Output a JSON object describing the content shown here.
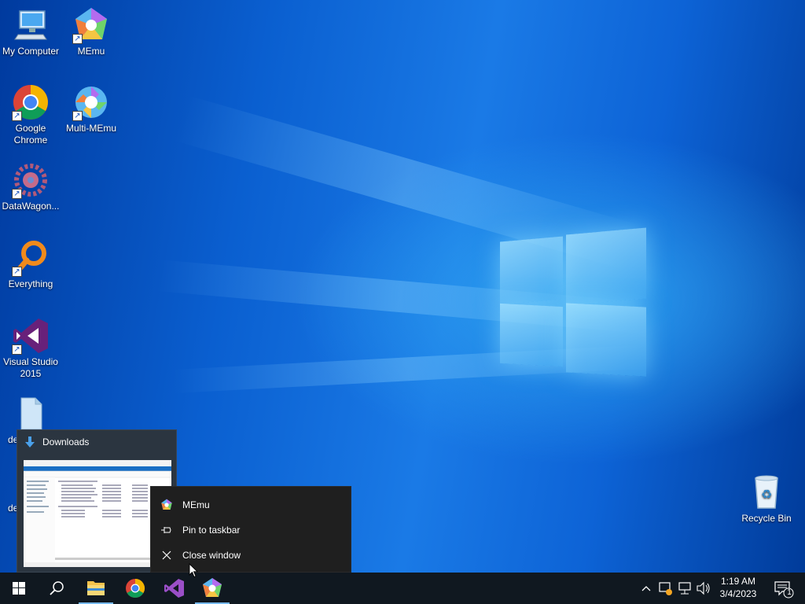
{
  "desktop": {
    "icons": [
      {
        "label": "My Computer",
        "icon": "monitor-icon"
      },
      {
        "label": "MEmu",
        "icon": "memu-icon"
      },
      {
        "label": "Google Chrome",
        "icon": "chrome-icon"
      },
      {
        "label": "Multi-MEmu",
        "icon": "multi-memu-icon"
      },
      {
        "label": "DataWagon...",
        "icon": "datawagon-icon"
      },
      {
        "label": "Everything",
        "icon": "search-magnifier-icon"
      },
      {
        "label": "Visual Studio 2015",
        "icon": "visual-studio-icon"
      },
      {
        "label": "de",
        "icon": "file-icon"
      },
      {
        "label": "de",
        "icon": "file-icon"
      },
      {
        "label": "Recycle Bin",
        "icon": "recycle-bin-icon"
      }
    ]
  },
  "preview": {
    "title": "Downloads",
    "icon": "download-arrow-icon"
  },
  "context_menu": {
    "items": [
      {
        "label": "MEmu",
        "icon": "memu-icon"
      },
      {
        "label": "Pin to taskbar",
        "icon": "pin-icon"
      },
      {
        "label": "Close window",
        "icon": "close-icon"
      }
    ]
  },
  "taskbar": {
    "buttons": [
      "start-icon",
      "search-icon",
      "file-explorer-icon",
      "chrome-icon",
      "visual-studio-icon",
      "memu-icon"
    ],
    "clock": {
      "time": "1:19 AM",
      "date": "3/4/2023"
    },
    "notifications_count": "1"
  },
  "colors": {
    "taskbar": "#101820",
    "menu_bg": "#1f1f1f",
    "accent": "#76b9ed"
  }
}
